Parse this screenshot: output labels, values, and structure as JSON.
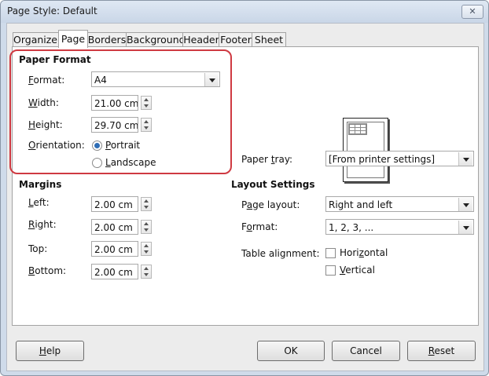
{
  "window": {
    "title": "Page Style: Default",
    "close_glyph": "✕"
  },
  "tabs": [
    {
      "label": "Organizer"
    },
    {
      "label": "Page"
    },
    {
      "label": "Borders"
    },
    {
      "label": "Background"
    },
    {
      "label": "Header"
    },
    {
      "label": "Footer"
    },
    {
      "label": "Sheet"
    }
  ],
  "paper_format": {
    "heading": "Paper Format",
    "format_label_key": "F",
    "format_label_rest": "ormat:",
    "format_value": "A4",
    "width_label_key": "W",
    "width_label_rest": "idth:",
    "width_value": "21.00 cm",
    "height_label_key": "H",
    "height_label_rest": "eight:",
    "height_value": "29.70 cm",
    "orientation_label_key": "O",
    "orientation_label_rest": "rientation:",
    "portrait_key": "P",
    "portrait_rest": "ortrait",
    "portrait_selected": true,
    "landscape_key": "L",
    "landscape_rest": "andscape"
  },
  "paper_tray": {
    "label_pre": "Paper ",
    "label_key": "t",
    "label_rest": "ray:",
    "value": "[From printer settings]"
  },
  "margins": {
    "heading": "Margins",
    "left_key": "L",
    "left_rest": "eft:",
    "left_value": "2.00 cm",
    "right_key": "R",
    "right_rest": "ight:",
    "right_value": "2.00 cm",
    "top_label": "Top:",
    "top_value": "2.00 cm",
    "bottom_key": "B",
    "bottom_rest": "ottom:",
    "bottom_value": "2.00 cm"
  },
  "layout_settings": {
    "heading": "Layout Settings",
    "page_layout_pre": "P",
    "page_layout_key": "a",
    "page_layout_rest": "ge layout:",
    "page_layout_value": "Right and left",
    "format_pre": "F",
    "format_key": "o",
    "format_rest": "rmat:",
    "format_value": "1, 2, 3, ...",
    "table_alignment_label": "Table alignment:",
    "horizontal_pre": "Hori",
    "horizontal_key": "z",
    "horizontal_rest": "ontal",
    "vertical_key": "V",
    "vertical_rest": "ertical"
  },
  "buttons": {
    "help_key": "H",
    "help_rest": "elp",
    "ok": "OK",
    "cancel": "Cancel",
    "reset_key": "R",
    "reset_rest": "eset"
  },
  "colors": {
    "highlight": "#cf3a42",
    "radio_selected": "#2f6db5",
    "dialog_bg": "#ececec"
  }
}
